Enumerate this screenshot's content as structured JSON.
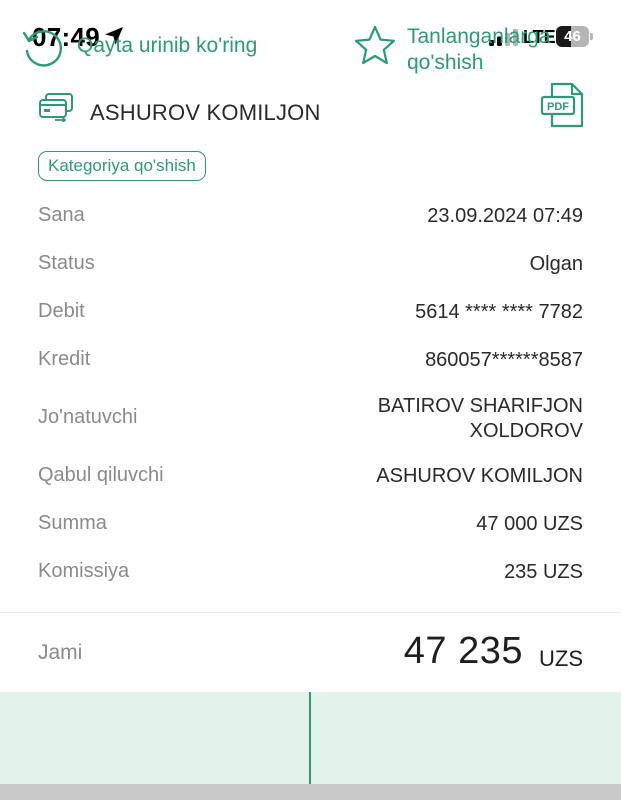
{
  "status_bar": {
    "time": "07:49",
    "network": "LTE",
    "battery": "46",
    "battery_level": 0.46
  },
  "header": {
    "title": "ASHUROV KOMILJON",
    "category_chip": "Kategoriya qo'shish",
    "icons": [
      "card-transfer-icon",
      "pdf-icon"
    ]
  },
  "details": [
    {
      "label": "Sana",
      "value": [
        "23.09.2024 07:49"
      ]
    },
    {
      "label": "Status",
      "value": [
        "Olgan"
      ]
    },
    {
      "label": "Debit",
      "value": [
        "5614 **** **** 7782"
      ]
    },
    {
      "label": "Kredit",
      "value": [
        "860057******8587"
      ]
    },
    {
      "label": "Jo'natuvchi",
      "value": [
        "BATIROV SHARIFJON",
        "XOLDOROV"
      ]
    },
    {
      "label": "Qabul qiluvchi",
      "value": [
        "ASHUROV KOMILJON"
      ]
    },
    {
      "label": "Summa",
      "value": [
        "47 000 UZS"
      ]
    },
    {
      "label": "Komissiya",
      "value": [
        "235 UZS"
      ]
    }
  ],
  "total": {
    "label": "Jami",
    "amount": "47 235",
    "currency": "UZS"
  },
  "actions": {
    "retry": "Qayta urinib ko'ring",
    "favorite": [
      "Tanlanganlarga",
      "qo'shish"
    ]
  },
  "colors": {
    "accent": "#2e9a74",
    "action_bg": "#e3f3ec",
    "label": "#8a8a8a"
  }
}
